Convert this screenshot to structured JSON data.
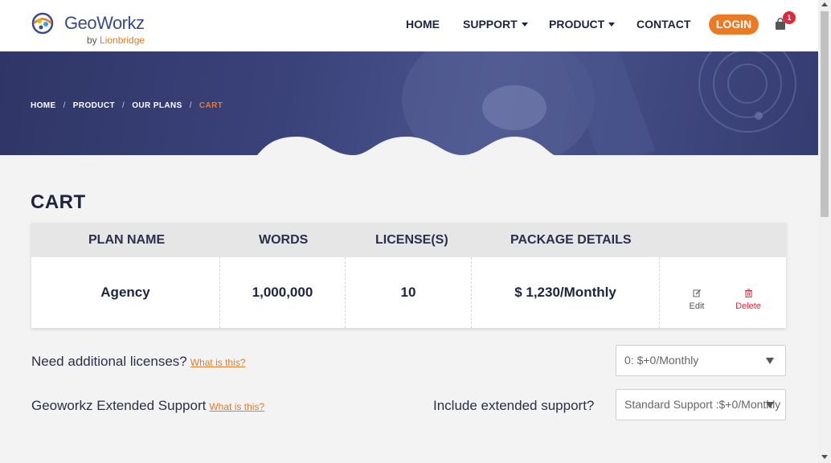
{
  "header": {
    "logo_text": "GeoWorkz",
    "logo_by": "by",
    "logo_brand": "Lionbridge",
    "nav": {
      "home": "HOME",
      "support": "SUPPORT",
      "product": "PRODUCT",
      "contact": "CONTACT"
    },
    "login": "LOGIN",
    "cart_count": "1"
  },
  "breadcrumb": {
    "home": "HOME",
    "product": "PRODUCT",
    "plans": "OUR PLANS",
    "current": "CART",
    "separator": "/"
  },
  "page_title": "CART",
  "table": {
    "headers": {
      "plan_name": "PLAN NAME",
      "words": "WORDS",
      "licenses": "LICENSE(S)",
      "package": "PACKAGE DETAILS"
    },
    "row": {
      "plan_name": "Agency",
      "words": "1,000,000",
      "licenses": "10",
      "price": "$ 1,230",
      "period": "/Monthly"
    },
    "actions": {
      "edit": "Edit",
      "delete": "Delete"
    }
  },
  "licenses_option": {
    "label": "Need additional licenses?",
    "link": "What is this?",
    "selected": "0: $+0/Monthly"
  },
  "support_option": {
    "label": "Geoworkz Extended Support",
    "link": "What is this?",
    "question": "Include extended support?",
    "selected": "Standard Support :$+0/Monthly"
  },
  "colors": {
    "accent": "#ec7a23",
    "navy": "#1e2440",
    "hero": "#3a427a",
    "danger": "#e0283a"
  }
}
